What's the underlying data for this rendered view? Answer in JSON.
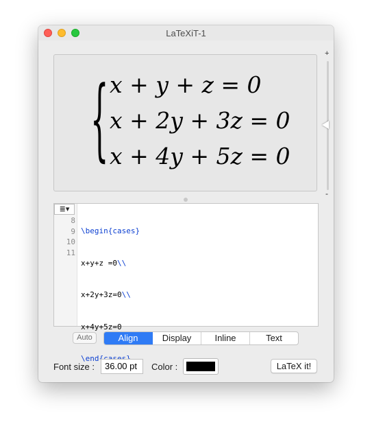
{
  "window": {
    "title": "LaTeXiT-1"
  },
  "preview": {
    "rows": [
      "x + y + z = 0",
      "x + 2y + 3z = 0",
      "x + 4y + 5z = 0"
    ],
    "brace": "{"
  },
  "slider": {
    "plus": "+",
    "minus": "-"
  },
  "editor": {
    "menu_icon": "≣▾",
    "line_numbers": [
      "8",
      "9",
      "10",
      "11"
    ],
    "lines": [
      {
        "text": "\\begin{cases}",
        "style": "kw"
      },
      {
        "text": "x+y+z =0",
        "tail": "\\\\"
      },
      {
        "text": "x+2y+3z=0",
        "tail": "\\\\"
      },
      {
        "text": "x+4y+5z=0",
        "tail": ""
      },
      {
        "text": "\\end{cases}",
        "style": "kw"
      }
    ]
  },
  "auto_label": "Auto",
  "modes": {
    "align": "Align",
    "display": "Display",
    "inline": "Inline",
    "text": "Text",
    "selected": "Align"
  },
  "font_size": {
    "label": "Font size :",
    "value": "36.00 pt"
  },
  "color": {
    "label": "Color :",
    "value": "#000000"
  },
  "latex_button": "LaTeX it!",
  "colors": {
    "accent": "#2f7bf5",
    "latex_keyword": "#0b3fd1"
  }
}
